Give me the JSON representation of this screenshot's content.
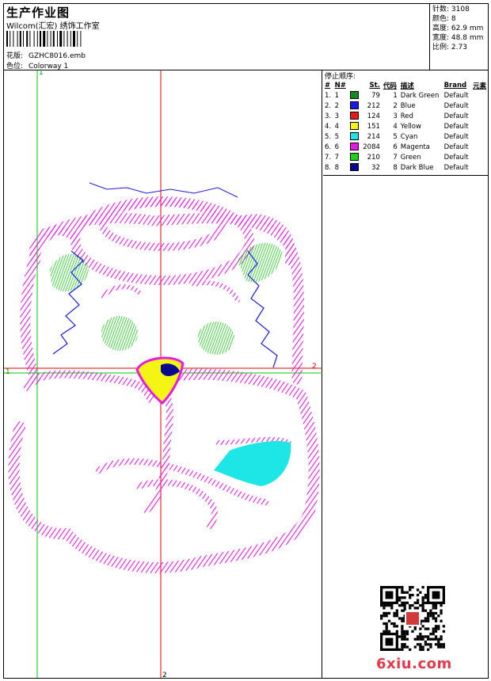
{
  "header": {
    "title": "生产作业图",
    "company": "Wilcom(汇宏) 绣饰工作室",
    "design_label": "花版:",
    "design_file": "GZHC8016.emb",
    "colorway_label": "色位:",
    "colorway": "Colorway 1"
  },
  "stats": [
    {
      "label": "针数:",
      "value": "3108"
    },
    {
      "label": "颜色:",
      "value": "8"
    },
    {
      "label": "高度:",
      "value": "62.9 mm"
    },
    {
      "label": "宽度:",
      "value": "48.8 mm"
    },
    {
      "label": "比例:",
      "value": "2.73"
    }
  ],
  "stop_sequence": {
    "title": "停止顺序:",
    "headers": [
      "#",
      "N#",
      "",
      "St.",
      "代码",
      "描述",
      "Brand",
      "元素"
    ],
    "rows": [
      {
        "num": "1.",
        "n": "1",
        "color": "#0f8a1e",
        "st": "79",
        "code": "1",
        "desc": "Dark Green",
        "brand": "Default"
      },
      {
        "num": "2.",
        "n": "2",
        "color": "#1a1ae6",
        "st": "212",
        "code": "2",
        "desc": "Blue",
        "brand": "Default"
      },
      {
        "num": "3.",
        "n": "3",
        "color": "#e61a1a",
        "st": "124",
        "code": "3",
        "desc": "Red",
        "brand": "Default"
      },
      {
        "num": "4.",
        "n": "4",
        "color": "#f5f514",
        "st": "151",
        "code": "4",
        "desc": "Yellow",
        "brand": "Default"
      },
      {
        "num": "5.",
        "n": "5",
        "color": "#1ee6e6",
        "st": "214",
        "code": "5",
        "desc": "Cyan",
        "brand": "Default"
      },
      {
        "num": "6.",
        "n": "6",
        "color": "#e61ae6",
        "st": "2084",
        "code": "6",
        "desc": "Magenta",
        "brand": "Default"
      },
      {
        "num": "7.",
        "n": "7",
        "color": "#1ad21a",
        "st": "210",
        "code": "7",
        "desc": "Green",
        "brand": "Default"
      },
      {
        "num": "8.",
        "n": "8",
        "color": "#0a0a8c",
        "st": "32",
        "code": "8",
        "desc": "Dark Blue",
        "brand": "Default"
      }
    ]
  },
  "axes": {
    "v_top": "1",
    "v_bottom": "2",
    "h_left": "1",
    "h_right": "2"
  },
  "watermark": "6xiu.com",
  "colors": {
    "magenta": "#e61ae6",
    "green_guide": "#00c800",
    "red_guide": "#e60000"
  }
}
